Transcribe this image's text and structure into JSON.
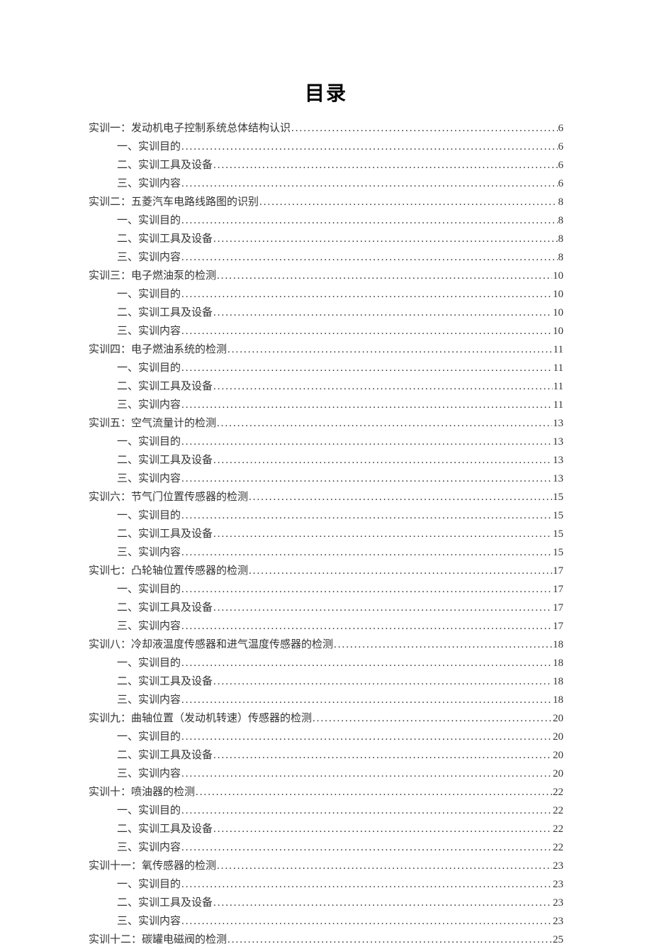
{
  "title": "目录",
  "entries": [
    {
      "level": 1,
      "text": "实训一：发动机电子控制系统总体结构认识",
      "page": "6"
    },
    {
      "level": 2,
      "text": "一、实训目的",
      "page": "6"
    },
    {
      "level": 2,
      "text": "二、实训工具及设备",
      "page": "6"
    },
    {
      "level": 2,
      "text": "三、实训内容",
      "page": "6"
    },
    {
      "level": 1,
      "text": "实训二：五菱汽车电路线路图的识别",
      "page": "8"
    },
    {
      "level": 2,
      "text": "一、实训目的",
      "page": "8"
    },
    {
      "level": 2,
      "text": "二、实训工具及设备",
      "page": "8"
    },
    {
      "level": 2,
      "text": "三、实训内容",
      "page": "8"
    },
    {
      "level": 1,
      "text": "实训三：电子燃油泵的检测",
      "page": "10"
    },
    {
      "level": 2,
      "text": "一、实训目的",
      "page": "10"
    },
    {
      "level": 2,
      "text": "二、实训工具及设备",
      "page": "10"
    },
    {
      "level": 2,
      "text": "三、实训内容",
      "page": "10"
    },
    {
      "level": 1,
      "text": "实训四：电子燃油系统的检测",
      "page": "11"
    },
    {
      "level": 2,
      "text": "一、实训目的",
      "page": "11"
    },
    {
      "level": 2,
      "text": "二、实训工具及设备",
      "page": "11"
    },
    {
      "level": 2,
      "text": "三、实训内容",
      "page": "11"
    },
    {
      "level": 1,
      "text": "实训五：空气流量计的检测",
      "page": "13"
    },
    {
      "level": 2,
      "text": "一、实训目的",
      "page": "13"
    },
    {
      "level": 2,
      "text": "二、实训工具及设备",
      "page": "13"
    },
    {
      "level": 2,
      "text": "三、实训内容",
      "page": "13"
    },
    {
      "level": 1,
      "text": "实训六：节气门位置传感器的检测",
      "page": "15"
    },
    {
      "level": 2,
      "text": "一、实训目的",
      "page": "15"
    },
    {
      "level": 2,
      "text": "二、实训工具及设备",
      "page": "15"
    },
    {
      "level": 2,
      "text": "三、实训内容",
      "page": "15"
    },
    {
      "level": 1,
      "text": "实训七：凸轮轴位置传感器的检测",
      "page": "17"
    },
    {
      "level": 2,
      "text": "一、实训目的",
      "page": "17"
    },
    {
      "level": 2,
      "text": "二、实训工具及设备",
      "page": "17"
    },
    {
      "level": 2,
      "text": "三、实训内容",
      "page": "17"
    },
    {
      "level": 1,
      "text": "实训八：冷却液温度传感器和进气温度传感器的检测",
      "page": "18"
    },
    {
      "level": 2,
      "text": "一、实训目的",
      "page": "18"
    },
    {
      "level": 2,
      "text": "二、实训工具及设备",
      "page": "18"
    },
    {
      "level": 2,
      "text": "三、实训内容",
      "page": "18"
    },
    {
      "level": 1,
      "text": "实训九：曲轴位置（发动机转速）传感器的检测",
      "page": "20"
    },
    {
      "level": 2,
      "text": "一、实训目的",
      "page": "20"
    },
    {
      "level": 2,
      "text": "二、实训工具及设备",
      "page": "20"
    },
    {
      "level": 2,
      "text": "三、实训内容",
      "page": "20"
    },
    {
      "level": 1,
      "text": "实训十：喷油器的检测",
      "page": "22"
    },
    {
      "level": 2,
      "text": "一、实训目的",
      "page": "22"
    },
    {
      "level": 2,
      "text": "二、实训工具及设备",
      "page": "22"
    },
    {
      "level": 2,
      "text": "三、实训内容",
      "page": "22"
    },
    {
      "level": 1,
      "text": "实训十一：氧传感器的检测",
      "page": "23"
    },
    {
      "level": 2,
      "text": "一、实训目的",
      "page": "23"
    },
    {
      "level": 2,
      "text": "二、实训工具及设备",
      "page": "23"
    },
    {
      "level": 2,
      "text": "三、实训内容",
      "page": "23"
    },
    {
      "level": 1,
      "text": "实训十二：碳罐电磁阀的检测",
      "page": "25"
    }
  ]
}
